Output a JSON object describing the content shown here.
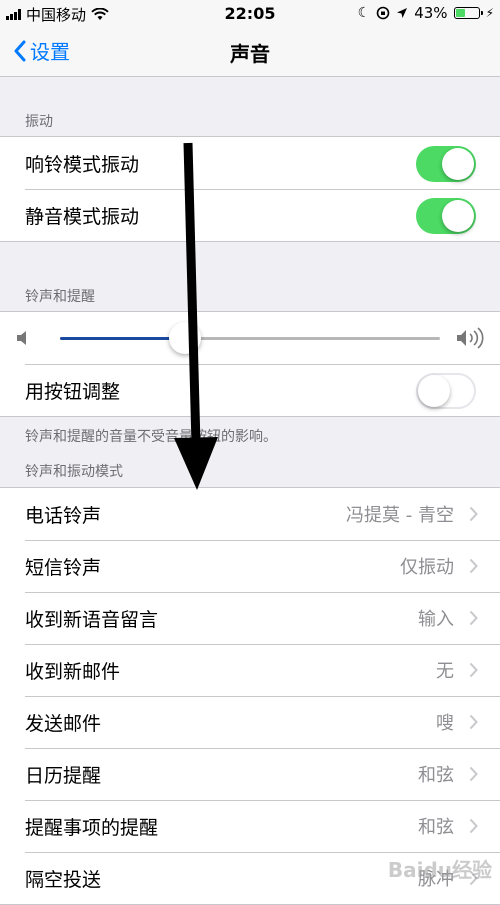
{
  "status_bar": {
    "carrier": "中国移动",
    "time": "22:05",
    "battery_percent": "43%",
    "battery_level": 0.43
  },
  "nav": {
    "back_label": "设置",
    "title": "声音"
  },
  "vibrate": {
    "header": "振动",
    "items": [
      {
        "label": "响铃模式振动",
        "on": true
      },
      {
        "label": "静音模式振动",
        "on": true
      }
    ]
  },
  "ringer": {
    "header": "铃声和提醒",
    "volume_level": 0.33,
    "change_with_buttons_label": "用按钮调整",
    "change_with_buttons_on": false,
    "footer": "铃声和提醒的音量不受音量按钮的影响。"
  },
  "sounds": {
    "header": "铃声和振动模式",
    "items": [
      {
        "label": "电话铃声",
        "value": "冯提莫 - 青空"
      },
      {
        "label": "短信铃声",
        "value": "仅振动"
      },
      {
        "label": "收到新语音留言",
        "value": "输入"
      },
      {
        "label": "收到新邮件",
        "value": "无"
      },
      {
        "label": "发送邮件",
        "value": "嗖"
      },
      {
        "label": "日历提醒",
        "value": "和弦"
      },
      {
        "label": "提醒事项的提醒",
        "value": "和弦"
      },
      {
        "label": "隔空投送",
        "value": "脉冲"
      }
    ]
  },
  "watermark": "Baidu经验",
  "colors": {
    "accent": "#007aff",
    "switch_on": "#4cd964",
    "arrow": "#000000"
  }
}
